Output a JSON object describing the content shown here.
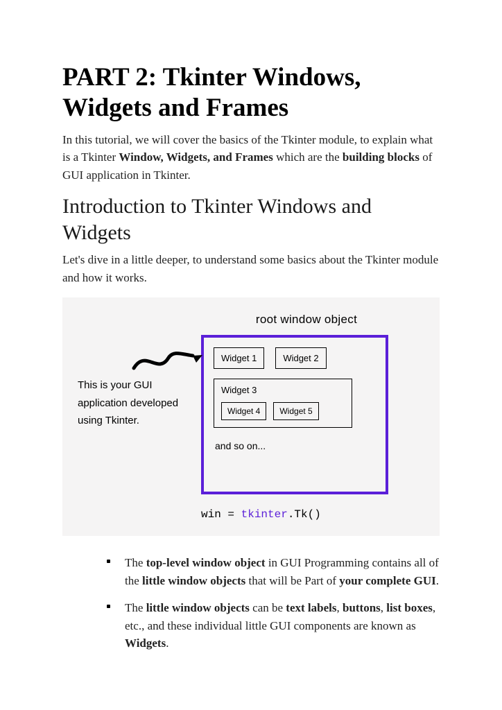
{
  "title": "PART 2:   Tkinter Windows, Widgets and Frames",
  "intro": {
    "seg1": "In this tutorial, we will cover the basics of the Tkinter module, to explain what is a Tkinter ",
    "b1": "Window, Widgets, and Frames",
    "seg2": " which are the ",
    "b2": "building blocks",
    "seg3": " of GUI application in Tkinter."
  },
  "subtitle": "Introduction to Tkinter Windows and Widgets",
  "lead": "Let's dive in a little deeper, to understand some basics about the Tkinter module and how it works.",
  "diagram": {
    "header": "root window object",
    "left_caption": "This is your GUI application developed using Tkinter.",
    "widgets": {
      "w1": "Widget 1",
      "w2": "Widget 2",
      "w3": "Widget 3",
      "w4": "Widget 4",
      "w5": "Widget 5"
    },
    "and_so_on": "and so on...",
    "code_plain": "win = ",
    "code_hl": "tkinter",
    "code_tail": ".Tk()"
  },
  "bullets": {
    "item1": {
      "s1": "The ",
      "b1": "top-level window object",
      "s2": " in GUI Programming contains all of the ",
      "b2": "little window objects",
      "s3": " that will be Part of ",
      "b3": "your complete GUI",
      "s4": "."
    },
    "item2": {
      "s1": "The ",
      "b1": "little window objects",
      "s2": " can be ",
      "b2": "text labels",
      "s3": ", ",
      "b3": "buttons",
      "s4": ", ",
      "b4": "list boxes",
      "s5": ", etc., and these individual little GUI components are known as ",
      "b5": "Widgets",
      "s6": "."
    }
  }
}
